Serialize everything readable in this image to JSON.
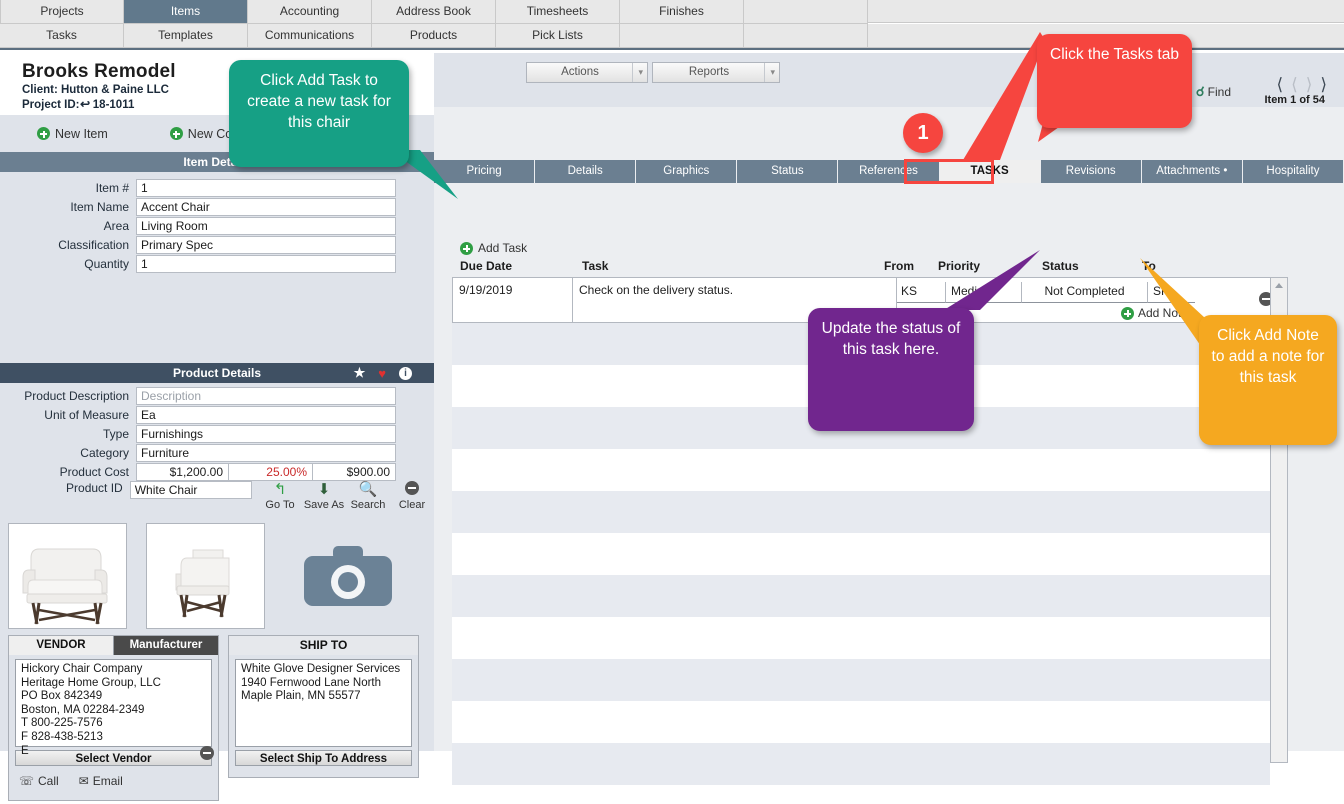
{
  "menu": {
    "row1": [
      "Projects",
      "Items",
      "Accounting",
      "Address Book",
      "Timesheets",
      "Finishes",
      ""
    ],
    "row2": [
      "Tasks",
      "Templates",
      "Communications",
      "Products",
      "Pick Lists",
      "",
      ""
    ],
    "active": "Items"
  },
  "project": {
    "title": "Brooks Remodel",
    "client": "Client: Hutton & Paine LLC",
    "project_id_label": "Project ID:",
    "project_id": "18-1011"
  },
  "left_actions": {
    "new_item": "New Item",
    "new_com": "New Com"
  },
  "item_details": {
    "section_title": "Item Details",
    "fields": [
      {
        "label": "Item #",
        "value": "1"
      },
      {
        "label": "Item Name",
        "value": "Accent Chair"
      },
      {
        "label": "Area",
        "value": "Living Room"
      },
      {
        "label": "Classification",
        "value": "Primary Spec"
      },
      {
        "label": "Quantity",
        "value": "1"
      }
    ]
  },
  "product_details": {
    "section_title": "Product Details",
    "icons": {
      "star": "star-icon",
      "heart": "heart-icon",
      "info": "info-icon"
    },
    "fields": [
      {
        "label": "Product Description",
        "value": "Description",
        "placeholder": true
      },
      {
        "label": "Unit of Measure",
        "value": "Ea"
      },
      {
        "label": "Type",
        "value": "Furnishings"
      },
      {
        "label": "Category",
        "value": "Furniture"
      }
    ],
    "cost_label": "Product Cost",
    "cost": "$1,200.00",
    "markup": "25.00%",
    "price": "$900.00",
    "product_id_label": "Product ID",
    "product_id": "White Chair",
    "tools": [
      {
        "label": "Go To",
        "icon": "arrow-goto-icon"
      },
      {
        "label": "Save As",
        "icon": "save-icon"
      },
      {
        "label": "Search",
        "icon": "search-icon"
      },
      {
        "label": "Clear",
        "icon": "minus-circle-icon"
      }
    ]
  },
  "vendor_card": {
    "tab_vendor": "VENDOR",
    "tab_manufacturer": "Manufacturer",
    "address": "Hickory Chair Company\nHeritage Home Group, LLC\nPO Box 842349\nBoston, MA 02284-2349\nT 800-225-7576\nF 828-438-5213\nE",
    "select_button": "Select Vendor",
    "call": "Call",
    "email": "Email"
  },
  "shipto_card": {
    "header": "SHIP TO",
    "address": "White Glove Designer Services\n1940 Fernwood Lane North\nMaple Plain, MN 55577",
    "select_button": "Select Ship To Address"
  },
  "right_toolbar": {
    "actions": "Actions",
    "reports": "Reports",
    "find": "Find",
    "item_count": "Item 1 of 54"
  },
  "right_tabs": [
    "Pricing",
    "Details",
    "Graphics",
    "Status",
    "References",
    "TASKS",
    "Revisions",
    "Attachments •",
    "Hospitality"
  ],
  "right_tabs_active": "TASKS",
  "tasks_panel": {
    "add_task": "Add Task",
    "add_note": "Add Note",
    "columns": [
      "Due Date",
      "Task",
      "From",
      "Priority",
      "Status",
      "To"
    ],
    "rows": [
      {
        "due_date": "9/19/2019",
        "task": "Check on the delivery status.",
        "from": "KS",
        "priority": "Medium",
        "status": "Not Completed",
        "to": "SP"
      }
    ]
  },
  "callouts": [
    {
      "id": "green",
      "text": "Click Add Task to create a new task for this chair",
      "color": "#16a085"
    },
    {
      "id": "red",
      "text": "Click the Tasks tab",
      "color": "#f6453f"
    },
    {
      "id": "purple",
      "text": "Update the status of this task here.",
      "color": "#71268e"
    },
    {
      "id": "orange",
      "text": "Click Add Note to add a note for this task",
      "color": "#f5a820"
    }
  ],
  "step_badge": "1"
}
